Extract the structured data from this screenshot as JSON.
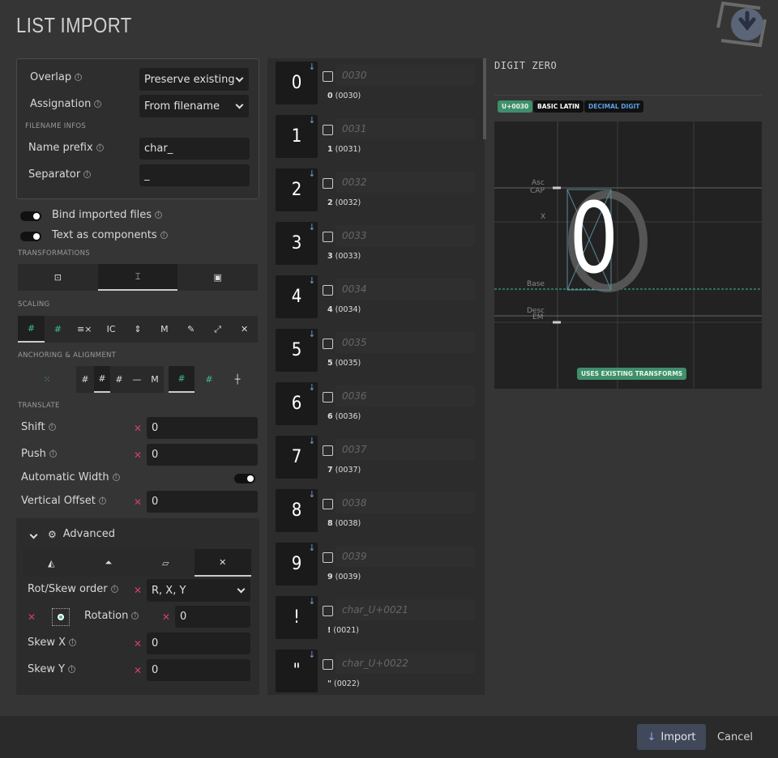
{
  "title": "LIST IMPORT",
  "settings": {
    "overlap_label": "Overlap",
    "overlap_value": "Preserve existing",
    "assignation_label": "Assignation",
    "assignation_value": "From filename",
    "filename_section": "FILENAME INFOS",
    "prefix_label": "Name prefix",
    "prefix_value": "char_",
    "separator_label": "Separator",
    "separator_value": "_",
    "bind_label": "Bind imported files",
    "text_label": "Text as components"
  },
  "sections": {
    "transformations": "TRANSFORMATIONS",
    "scaling": "SCALING",
    "anchoring": "ANCHORING & ALIGNMENT",
    "translate": "TRANSLATE"
  },
  "translate": {
    "shift_label": "Shift",
    "shift_value": "0",
    "push_label": "Push",
    "push_value": "0",
    "auto_width_label": "Automatic Width",
    "voffset_label": "Vertical Offset",
    "voffset_value": "0"
  },
  "advanced": {
    "label": "Advanced",
    "order_label": "Rot/Skew order",
    "order_value": "R, X, Y",
    "rotation_label": "Rotation",
    "rotation_value": "0",
    "skewx_label": "Skew X",
    "skewx_value": "0",
    "skewy_label": "Skew Y",
    "skewy_value": "0"
  },
  "glyphs": [
    {
      "char": "0",
      "placeholder": "0030",
      "caption_char": "0",
      "caption_code": "(0030)"
    },
    {
      "char": "1",
      "placeholder": "0031",
      "caption_char": "1",
      "caption_code": "(0031)"
    },
    {
      "char": "2",
      "placeholder": "0032",
      "caption_char": "2",
      "caption_code": "(0032)"
    },
    {
      "char": "3",
      "placeholder": "0033",
      "caption_char": "3",
      "caption_code": "(0033)"
    },
    {
      "char": "4",
      "placeholder": "0034",
      "caption_char": "4",
      "caption_code": "(0034)"
    },
    {
      "char": "5",
      "placeholder": "0035",
      "caption_char": "5",
      "caption_code": "(0035)"
    },
    {
      "char": "6",
      "placeholder": "0036",
      "caption_char": "6",
      "caption_code": "(0036)"
    },
    {
      "char": "7",
      "placeholder": "0037",
      "caption_char": "7",
      "caption_code": "(0037)"
    },
    {
      "char": "8",
      "placeholder": "0038",
      "caption_char": "8",
      "caption_code": "(0038)"
    },
    {
      "char": "9",
      "placeholder": "0039",
      "caption_char": "9",
      "caption_code": "(0039)"
    },
    {
      "char": "!",
      "placeholder": "char_U+0021",
      "caption_char": "!",
      "caption_code": "(0021)"
    },
    {
      "char": "\"",
      "placeholder": "char_U+0022",
      "caption_char": "\"",
      "caption_code": "(0022)"
    }
  ],
  "preview": {
    "glyph_name": "DIGIT ZERO",
    "tag_unicode": "U+0030",
    "tag_block": "BASIC LATIN",
    "tag_category": "DECIMAL DIGIT",
    "glyph": "0",
    "metric_asc": "Asc",
    "metric_cap": "CAP",
    "metric_x": "X",
    "metric_base": "Base",
    "metric_desc": "Desc",
    "metric_em": "EM",
    "badge": "USES EXISTING TRANSFORMS"
  },
  "footer": {
    "import_label": "Import",
    "cancel_label": "Cancel"
  },
  "colors": {
    "accent_green": "#3f8f6a",
    "accent_blue": "#7fa0d8",
    "remove_red": "#d0406a"
  }
}
